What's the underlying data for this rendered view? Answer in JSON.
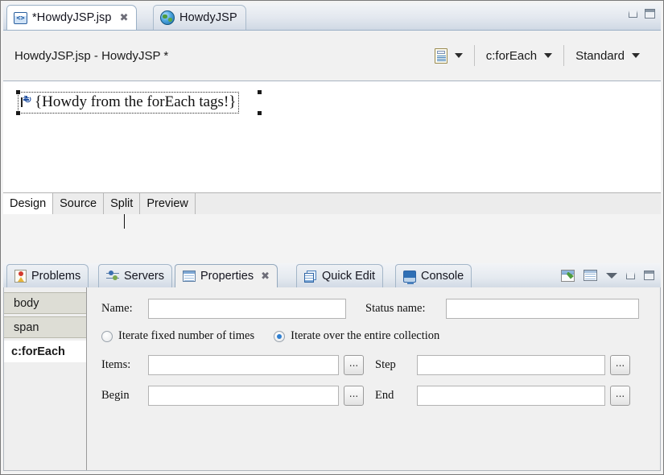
{
  "window": {
    "minimize_label": "Minimize",
    "maximize_label": "Maximize"
  },
  "editor": {
    "tabs": [
      {
        "label": "*HowdyJSP.jsp",
        "icon": "jsp-file-icon",
        "active": true,
        "closeable": true,
        "close_glyph": "✖"
      },
      {
        "label": "HowdyJSP",
        "icon": "globe-icon",
        "active": false,
        "closeable": false
      }
    ],
    "toolbar": {
      "title": "HowdyJSP.jsp - HowdyJSP *",
      "page_icon": "page-properties-icon",
      "page_caret": "chevron-down-icon",
      "tag_selector": "c:forEach",
      "tag_caret": "chevron-down-icon",
      "style_selector": "Standard",
      "style_caret": "chevron-down-icon"
    },
    "canvas": {
      "selected_element_icon": "jsp-tag-marker-icon",
      "selected_text": "{Howdy from the forEach tags!}"
    },
    "mode_tabs": [
      {
        "label": "Design",
        "active": true
      },
      {
        "label": "Source",
        "active": false
      },
      {
        "label": "Split",
        "active": false
      },
      {
        "label": "Preview",
        "active": false
      }
    ]
  },
  "bottom_panel": {
    "tabs": [
      {
        "label": "Problems",
        "icon": "problems-icon",
        "active": false,
        "closeable": false
      },
      {
        "label": "Servers",
        "icon": "servers-icon",
        "active": false,
        "closeable": false
      },
      {
        "label": "Properties",
        "icon": "properties-icon",
        "active": true,
        "closeable": true,
        "close_glyph": "✖"
      },
      {
        "label": "Quick Edit",
        "icon": "quick-edit-icon",
        "active": false,
        "closeable": false
      },
      {
        "label": "Console",
        "icon": "console-icon",
        "active": false,
        "closeable": false
      }
    ],
    "toolbar_icons": [
      {
        "name": "pin-view-icon"
      },
      {
        "name": "show-list-icon"
      },
      {
        "name": "view-menu-icon"
      },
      {
        "name": "minimize-icon"
      },
      {
        "name": "maximize-icon"
      }
    ]
  },
  "properties": {
    "breadcrumbs": [
      {
        "label": "body",
        "selected": false
      },
      {
        "label": "span",
        "selected": false
      },
      {
        "label": "c:forEach",
        "selected": true
      }
    ],
    "fields": {
      "name_label": "Name:",
      "name_value": "",
      "name_placeholder": "",
      "status_name_label": "Status name:",
      "status_name_value": "",
      "status_name_placeholder": "",
      "items_label": "Items:",
      "items_value": "",
      "items_placeholder": "",
      "step_label": "Step",
      "step_value": "",
      "step_placeholder": "",
      "begin_label": "Begin",
      "begin_value": "",
      "begin_placeholder": "",
      "end_label": "End",
      "end_value": "",
      "end_placeholder": "",
      "browse_label": "..."
    },
    "radios": [
      {
        "label": "Iterate fixed number of times",
        "selected": false
      },
      {
        "label": "Iterate over the entire collection",
        "selected": true
      }
    ]
  },
  "colors": {
    "accent_blue": "#2f7fd0",
    "tab_active_bg": "#ffffff",
    "panel_bg": "#f0f0f0",
    "crumb_bg": "#ddddd5"
  }
}
